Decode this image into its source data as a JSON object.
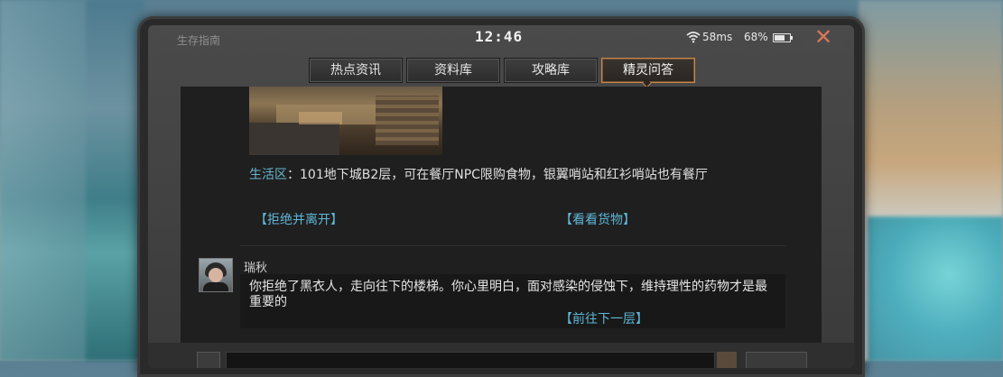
{
  "statusbar": {
    "app_title": "生存指南",
    "clock": "12:46",
    "ping": "58ms",
    "battery": "68%",
    "battery_level": 0.68,
    "close_glyph": "✕"
  },
  "tabs": [
    {
      "label": "热点资讯",
      "active": false
    },
    {
      "label": "资料库",
      "active": false
    },
    {
      "label": "攻略库",
      "active": false
    },
    {
      "label": "精灵问答",
      "active": true
    }
  ],
  "answer": {
    "tag": "生活区",
    "text": "：101地下城B2层，可在餐厅NPC限购食物，银翼哨站和红衫哨站也有餐厅",
    "options": [
      "【拒绝并离开】",
      "【看看货物】"
    ]
  },
  "dialog": {
    "speaker": "瑞秋",
    "text": "你拒绝了黑衣人，走向往下的楼梯。你心里明白，面对感染的侵蚀下，维持理性的药物才是最重要的",
    "option": "【前往下一层】"
  },
  "colors": {
    "accent_tab": "#c78a4a",
    "link": "#5fb6d6",
    "close": "#d8775a"
  }
}
